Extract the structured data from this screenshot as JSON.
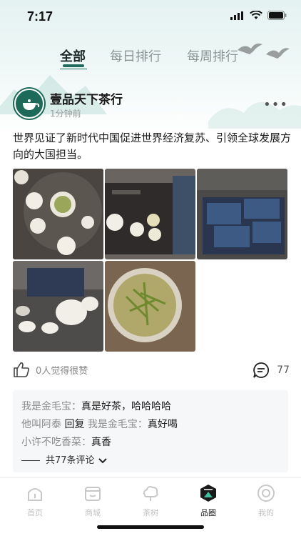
{
  "status": {
    "time": "7:17"
  },
  "tabs": [
    {
      "label": "全部",
      "active": true
    },
    {
      "label": "每日排行",
      "active": false
    },
    {
      "label": "每周排行",
      "active": false
    }
  ],
  "post": {
    "author": "壹品天下茶行",
    "time": "1分钟前",
    "text": "世界见证了新时代中国促进世界经济复苏、引领全球发展方向的大国担当。",
    "photos": [
      "tea-set",
      "tea-tray",
      "gift-box",
      "tea-pot",
      "green-tea-glass"
    ]
  },
  "actions": {
    "likes": "0人觉得很赞",
    "comment_count": "77"
  },
  "comments": {
    "items": [
      {
        "user": "我是金毛宝：",
        "body": "真是好茶，哈哈哈哈"
      },
      {
        "user": "他叫阿泰",
        "reply_word": "回复",
        "reply_to": "我是金毛宝：",
        "body": "真好喝"
      },
      {
        "user": "小许不吃香菜：",
        "body": "真香"
      }
    ],
    "total": "共77条评论"
  },
  "tabbar": [
    {
      "label": "首页",
      "icon": "home-icon",
      "active": false
    },
    {
      "label": "商城",
      "icon": "shop-icon",
      "active": false
    },
    {
      "label": "茶树",
      "icon": "tree-icon",
      "active": false
    },
    {
      "label": "品圈",
      "icon": "circle-icon",
      "active": true
    },
    {
      "label": "我的",
      "icon": "profile-icon",
      "active": false
    }
  ],
  "colors": {
    "brand": "#1f6b5d",
    "muted": "#8a9494"
  }
}
